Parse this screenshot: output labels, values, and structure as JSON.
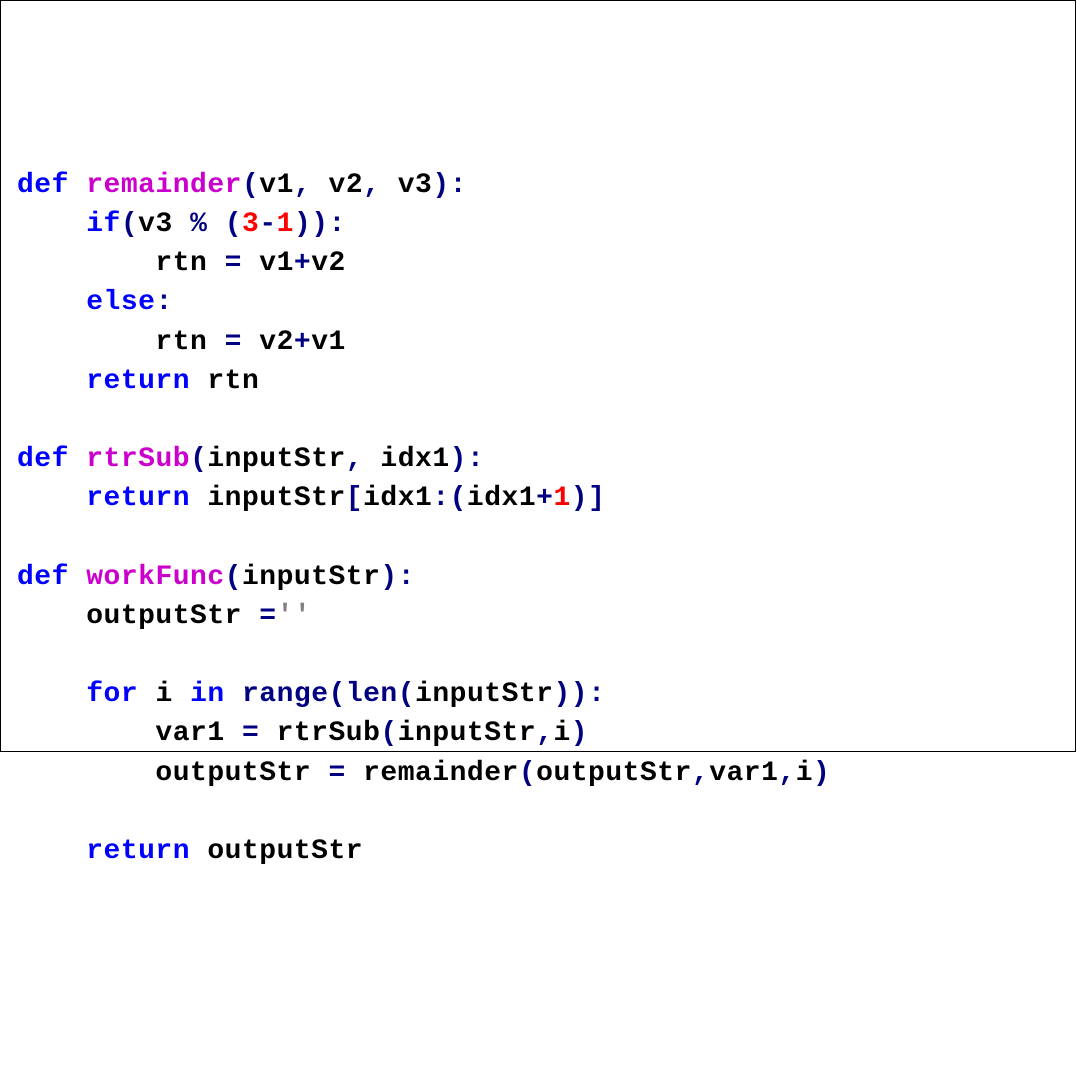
{
  "code": {
    "lines": [
      {
        "indent": 0,
        "tokens": [
          {
            "t": "kw",
            "v": "def"
          },
          {
            "t": "sp",
            "v": " "
          },
          {
            "t": "func",
            "v": "remainder"
          },
          {
            "t": "paren",
            "v": "("
          },
          {
            "t": "id",
            "v": "v1"
          },
          {
            "t": "paren",
            "v": ","
          },
          {
            "t": "sp",
            "v": " "
          },
          {
            "t": "id",
            "v": "v2"
          },
          {
            "t": "paren",
            "v": ","
          },
          {
            "t": "sp",
            "v": " "
          },
          {
            "t": "id",
            "v": "v3"
          },
          {
            "t": "paren",
            "v": "):"
          }
        ]
      },
      {
        "indent": 1,
        "tokens": [
          {
            "t": "kw",
            "v": "if"
          },
          {
            "t": "paren",
            "v": "("
          },
          {
            "t": "id",
            "v": "v3"
          },
          {
            "t": "sp",
            "v": " "
          },
          {
            "t": "op",
            "v": "%"
          },
          {
            "t": "sp",
            "v": " "
          },
          {
            "t": "paren",
            "v": "("
          },
          {
            "t": "num",
            "v": "3"
          },
          {
            "t": "op",
            "v": "-"
          },
          {
            "t": "num",
            "v": "1"
          },
          {
            "t": "paren",
            "v": ")):"
          }
        ]
      },
      {
        "indent": 2,
        "tokens": [
          {
            "t": "id",
            "v": "rtn"
          },
          {
            "t": "sp",
            "v": " "
          },
          {
            "t": "op",
            "v": "="
          },
          {
            "t": "sp",
            "v": " "
          },
          {
            "t": "id",
            "v": "v1"
          },
          {
            "t": "op",
            "v": "+"
          },
          {
            "t": "id",
            "v": "v2"
          }
        ]
      },
      {
        "indent": 1,
        "tokens": [
          {
            "t": "kw",
            "v": "else"
          },
          {
            "t": "paren",
            "v": ":"
          }
        ]
      },
      {
        "indent": 2,
        "tokens": [
          {
            "t": "id",
            "v": "rtn"
          },
          {
            "t": "sp",
            "v": " "
          },
          {
            "t": "op",
            "v": "="
          },
          {
            "t": "sp",
            "v": " "
          },
          {
            "t": "id",
            "v": "v2"
          },
          {
            "t": "op",
            "v": "+"
          },
          {
            "t": "id",
            "v": "v1"
          }
        ]
      },
      {
        "indent": 1,
        "tokens": [
          {
            "t": "kw",
            "v": "return"
          },
          {
            "t": "sp",
            "v": " "
          },
          {
            "t": "id",
            "v": "rtn"
          }
        ]
      },
      {
        "indent": 0,
        "tokens": []
      },
      {
        "indent": 0,
        "tokens": [
          {
            "t": "kw",
            "v": "def"
          },
          {
            "t": "sp",
            "v": " "
          },
          {
            "t": "func",
            "v": "rtrSub"
          },
          {
            "t": "paren",
            "v": "("
          },
          {
            "t": "id",
            "v": "inputStr"
          },
          {
            "t": "paren",
            "v": ","
          },
          {
            "t": "sp",
            "v": " "
          },
          {
            "t": "id",
            "v": "idx1"
          },
          {
            "t": "paren",
            "v": "):"
          }
        ]
      },
      {
        "indent": 1,
        "tokens": [
          {
            "t": "kw",
            "v": "return"
          },
          {
            "t": "sp",
            "v": " "
          },
          {
            "t": "id",
            "v": "inputStr"
          },
          {
            "t": "paren",
            "v": "["
          },
          {
            "t": "id",
            "v": "idx1"
          },
          {
            "t": "paren",
            "v": ":("
          },
          {
            "t": "id",
            "v": "idx1"
          },
          {
            "t": "op",
            "v": "+"
          },
          {
            "t": "num",
            "v": "1"
          },
          {
            "t": "paren",
            "v": ")]"
          }
        ]
      },
      {
        "indent": 0,
        "tokens": []
      },
      {
        "indent": 0,
        "tokens": [
          {
            "t": "kw",
            "v": "def"
          },
          {
            "t": "sp",
            "v": " "
          },
          {
            "t": "func",
            "v": "workFunc"
          },
          {
            "t": "paren",
            "v": "("
          },
          {
            "t": "id",
            "v": "inputStr"
          },
          {
            "t": "paren",
            "v": "):"
          }
        ]
      },
      {
        "indent": 1,
        "tokens": [
          {
            "t": "id",
            "v": "outputStr"
          },
          {
            "t": "sp",
            "v": " "
          },
          {
            "t": "op",
            "v": "="
          },
          {
            "t": "str",
            "v": "''"
          }
        ]
      },
      {
        "indent": 0,
        "tokens": []
      },
      {
        "indent": 1,
        "tokens": [
          {
            "t": "kw",
            "v": "for"
          },
          {
            "t": "sp",
            "v": " "
          },
          {
            "t": "id",
            "v": "i"
          },
          {
            "t": "sp",
            "v": " "
          },
          {
            "t": "kw",
            "v": "in"
          },
          {
            "t": "sp",
            "v": " "
          },
          {
            "t": "builtin",
            "v": "range"
          },
          {
            "t": "paren",
            "v": "("
          },
          {
            "t": "builtin",
            "v": "len"
          },
          {
            "t": "paren",
            "v": "("
          },
          {
            "t": "id",
            "v": "inputStr"
          },
          {
            "t": "paren",
            "v": ")):"
          }
        ]
      },
      {
        "indent": 2,
        "tokens": [
          {
            "t": "id",
            "v": "var1"
          },
          {
            "t": "sp",
            "v": " "
          },
          {
            "t": "op",
            "v": "="
          },
          {
            "t": "sp",
            "v": " "
          },
          {
            "t": "id",
            "v": "rtrSub"
          },
          {
            "t": "paren",
            "v": "("
          },
          {
            "t": "id",
            "v": "inputStr"
          },
          {
            "t": "paren",
            "v": ","
          },
          {
            "t": "id",
            "v": "i"
          },
          {
            "t": "paren",
            "v": ")"
          }
        ]
      },
      {
        "indent": 2,
        "tokens": [
          {
            "t": "id",
            "v": "outputStr"
          },
          {
            "t": "sp",
            "v": " "
          },
          {
            "t": "op",
            "v": "="
          },
          {
            "t": "sp",
            "v": " "
          },
          {
            "t": "id",
            "v": "remainder"
          },
          {
            "t": "paren",
            "v": "("
          },
          {
            "t": "id",
            "v": "outputStr"
          },
          {
            "t": "paren",
            "v": ","
          },
          {
            "t": "id",
            "v": "var1"
          },
          {
            "t": "paren",
            "v": ","
          },
          {
            "t": "id",
            "v": "i"
          },
          {
            "t": "paren",
            "v": ")"
          }
        ]
      },
      {
        "indent": 0,
        "tokens": []
      },
      {
        "indent": 1,
        "tokens": [
          {
            "t": "kw",
            "v": "return"
          },
          {
            "t": "sp",
            "v": " "
          },
          {
            "t": "id",
            "v": "outputStr"
          }
        ]
      }
    ],
    "indent_unit": "    "
  }
}
